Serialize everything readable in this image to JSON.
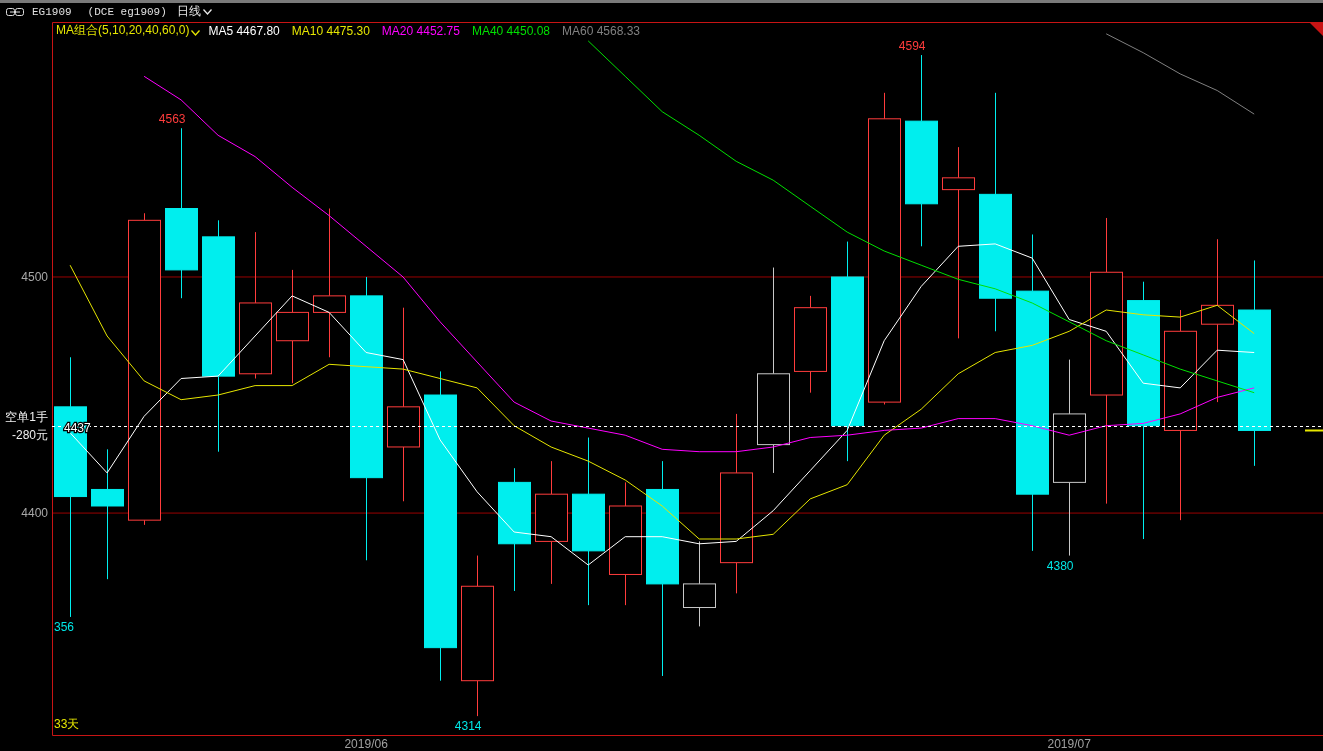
{
  "window": {
    "symbol": "EG1909",
    "exchange": "(DCE eg1909)",
    "period": "日线"
  },
  "legend": {
    "group": "MA组合(5,10,20,40,60,0)",
    "values": [
      "4467.80",
      "4475.30",
      "4452.75",
      "4450.08",
      "4568.33"
    ]
  },
  "position": {
    "label": "空单1手",
    "pnl": "-280元"
  },
  "day_count": "33天",
  "last_close_marker": {
    "color": "#e6e600"
  },
  "candles": [
    {
      "kind": "down",
      "low_label": "356"
    },
    {
      "kind": "down"
    },
    {
      "kind": "up"
    },
    {
      "kind": "down",
      "high_label": "4563"
    },
    {
      "kind": "down"
    },
    {
      "kind": "up"
    },
    {
      "kind": "up"
    },
    {
      "kind": "up"
    },
    {
      "kind": "down"
    },
    {
      "kind": "up"
    },
    {
      "kind": "down"
    },
    {
      "kind": "up",
      "low_label": "4314"
    },
    {
      "kind": "down"
    },
    {
      "kind": "up"
    },
    {
      "kind": "down"
    },
    {
      "kind": "up"
    },
    {
      "kind": "down"
    },
    {
      "kind": "neutral"
    },
    {
      "kind": "up"
    },
    {
      "kind": "neutral"
    },
    {
      "kind": "up"
    },
    {
      "kind": "down"
    },
    {
      "kind": "up"
    },
    {
      "kind": "down",
      "high_label": "4594"
    },
    {
      "kind": "up"
    },
    {
      "kind": "down"
    },
    {
      "kind": "down"
    },
    {
      "kind": "neutral",
      "low_label": "4380"
    },
    {
      "kind": "up"
    },
    {
      "kind": "down"
    },
    {
      "kind": "up"
    },
    {
      "kind": "up"
    },
    {
      "kind": "down"
    }
  ],
  "chart_data": {
    "type": "line",
    "categories": [
      null,
      null,
      null,
      null,
      null,
      null,
      null,
      null,
      "2019/06",
      null,
      null,
      null,
      null,
      null,
      null,
      null,
      null,
      null,
      null,
      null,
      null,
      null,
      null,
      null,
      null,
      null,
      null,
      "2019/07",
      null,
      null,
      null,
      null,
      null
    ],
    "ylim": [
      4306,
      4608
    ],
    "yticks": [
      4400,
      4500
    ],
    "series": [
      {
        "name": "MA5",
        "color": "#ffffff",
        "values": [
          4434,
          4417,
          4441,
          4457,
          4458,
          4475,
          4492,
          4485,
          4468,
          4465,
          4431,
          4409,
          4392,
          4390,
          4378,
          4390,
          4390,
          4387,
          4388,
          4401,
          4418,
          4435,
          4473,
          4496,
          4513,
          4514,
          4508,
          4482,
          4477,
          4455,
          4453,
          4469,
          4468
        ]
      },
      {
        "name": "MA10",
        "color": "#e6e600",
        "values": [
          4505,
          4475,
          4456,
          4448,
          4450,
          4454,
          4454,
          4463,
          4462,
          4461,
          4457,
          4453,
          4437,
          4428,
          4422,
          4414,
          4403,
          4389,
          4389,
          4391,
          4406,
          4412,
          4433,
          4444,
          4459,
          4468,
          4471,
          4477,
          4486,
          4484,
          4483,
          4488,
          4476
        ]
      },
      {
        "name": "MA20",
        "color": "#ff00ff",
        "values": [
          null,
          null,
          4585,
          4575,
          4560,
          4551,
          4538,
          4526,
          4513,
          4500,
          4481,
          4464,
          4447,
          4439,
          4436,
          4433,
          4427,
          4426,
          4426,
          4428,
          4432,
          4433,
          4435,
          4436,
          4440,
          4440,
          4437,
          4433,
          4437,
          4438,
          4442,
          4449,
          4453
        ]
      },
      {
        "name": "MA40",
        "color": "#00e000",
        "values": [
          null,
          null,
          null,
          null,
          null,
          null,
          null,
          null,
          null,
          null,
          null,
          null,
          null,
          null,
          4600,
          4585,
          4570,
          4560,
          4549,
          4541,
          4530,
          4519,
          4511,
          4505,
          4499,
          4495,
          4489,
          4481,
          4473,
          4467,
          4461,
          4456,
          4451
        ]
      },
      {
        "name": "MA60",
        "color": "#808080",
        "values": [
          null,
          null,
          null,
          null,
          null,
          null,
          null,
          null,
          null,
          null,
          null,
          null,
          null,
          null,
          null,
          null,
          null,
          null,
          null,
          null,
          null,
          null,
          null,
          null,
          null,
          null,
          null,
          null,
          4603,
          4595,
          4586,
          4579,
          4569
        ]
      }
    ],
    "ref_lines": [
      {
        "axis": "y",
        "value": 4437,
        "label": "4437",
        "color": "#ffffff"
      }
    ]
  }
}
